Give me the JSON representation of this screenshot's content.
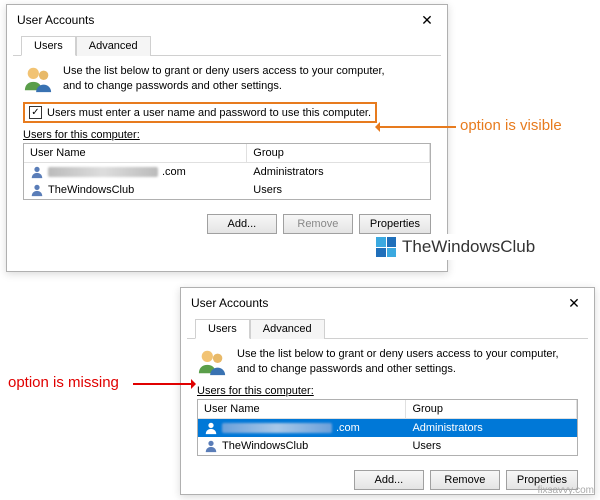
{
  "dialog1": {
    "title": "User Accounts",
    "tabs": [
      "Users",
      "Advanced"
    ],
    "intro1": "Use the list below to grant or deny users access to your computer,",
    "intro2": "and to change passwords and other settings.",
    "checkbox_checked": true,
    "option_label": "Users must enter a user name and password to use this computer.",
    "section_label": "Users for this computer:",
    "columns": {
      "user": "User Name",
      "group": "Group"
    },
    "rows": [
      {
        "user_suffix": ".com",
        "group": "Administrators",
        "blurred": true
      },
      {
        "user": "TheWindowsClub",
        "group": "Users",
        "blurred": false
      }
    ],
    "buttons": {
      "add": "Add...",
      "remove": "Remove",
      "properties": "Properties"
    }
  },
  "dialog2": {
    "title": "User Accounts",
    "tabs": [
      "Users",
      "Advanced"
    ],
    "intro1": "Use the list below to grant or deny users access to your computer,",
    "intro2": "and to change passwords and other settings.",
    "section_label": "Users for this computer:",
    "columns": {
      "user": "User Name",
      "group": "Group"
    },
    "rows": [
      {
        "user_suffix": ".com",
        "group": "Administrators",
        "blurred": true,
        "selected": true
      },
      {
        "user": "TheWindowsClub",
        "group": "Users",
        "blurred": false
      }
    ],
    "buttons": {
      "add": "Add...",
      "remove": "Remove",
      "properties": "Properties"
    }
  },
  "annotations": {
    "visible": "option is visible",
    "missing": "option is missing",
    "logo_text": "TheWindowsClub",
    "watermark": "fixsavvy.com"
  }
}
